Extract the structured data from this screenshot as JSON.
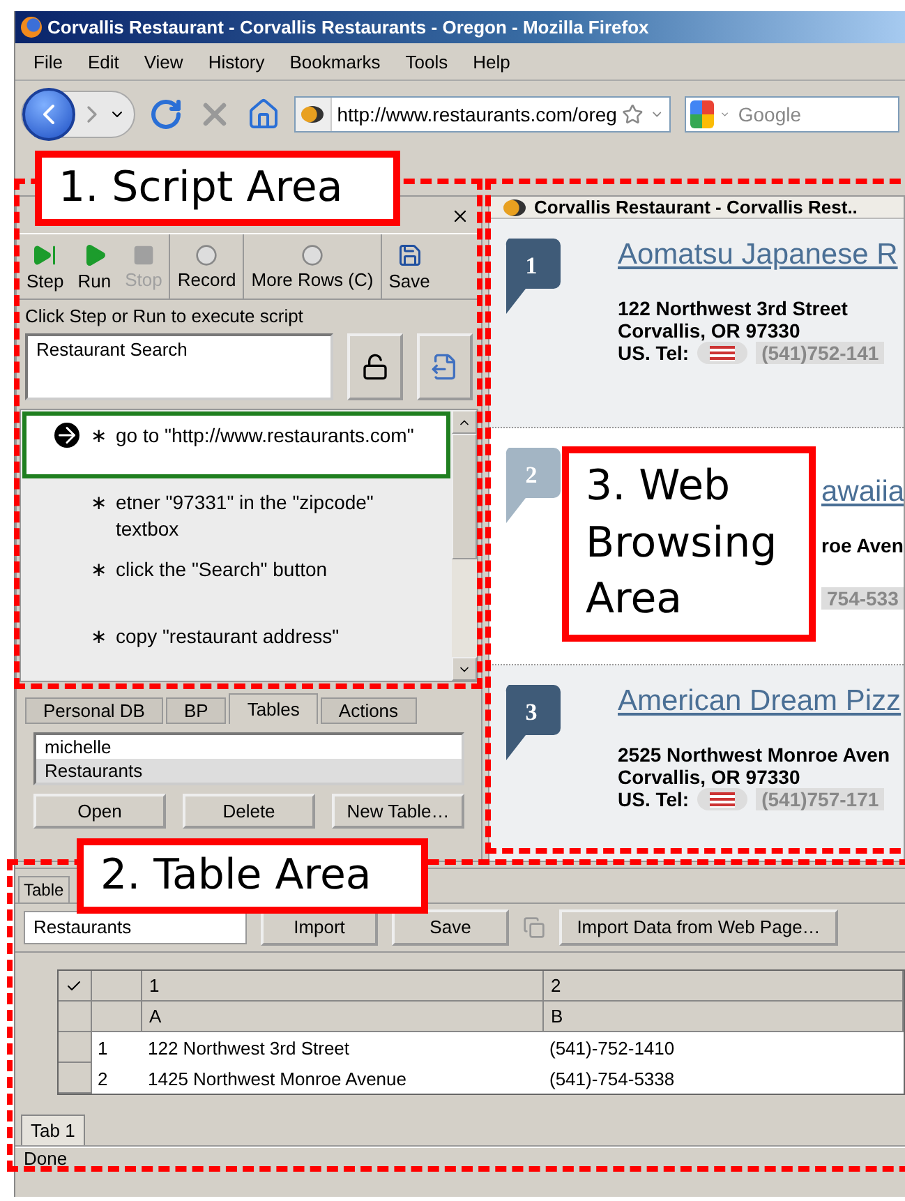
{
  "window": {
    "title": "Corvallis Restaurant - Corvallis Restaurants - Oregon - Mozilla Firefox"
  },
  "menu": [
    "File",
    "Edit",
    "View",
    "History",
    "Bookmarks",
    "Tools",
    "Help"
  ],
  "nav": {
    "url": "http://www.restaurants.com/oreg",
    "search_placeholder": "Google"
  },
  "sidebar": {
    "toolbar": [
      {
        "label": "Step",
        "kind": "step",
        "disabled": false
      },
      {
        "label": "Run",
        "kind": "run",
        "disabled": false
      },
      {
        "label": "Stop",
        "kind": "stop",
        "disabled": true
      },
      {
        "label": "Record",
        "kind": "record",
        "disabled": false
      },
      {
        "label": "More Rows (C)",
        "kind": "record",
        "disabled": false
      },
      {
        "label": "Save",
        "kind": "save",
        "disabled": false
      }
    ],
    "hint": "Click Step or Run to execute script",
    "script_name": "Restaurant Search",
    "steps": [
      {
        "bullet": "∗",
        "text": "go to \"http://www.restaurants.com\"",
        "selected": true
      },
      {
        "bullet": "∗",
        "text": "etner \"97331\" in the \"zipcode\" textbox",
        "selected": false
      },
      {
        "bullet": "∗",
        "text": "click the \"Search\" button",
        "selected": false
      },
      {
        "bullet": "∗",
        "text": "copy \"restaurant address\"",
        "selected": false
      }
    ],
    "tabs": [
      {
        "label": "Personal DB",
        "selected": false
      },
      {
        "label": "BP",
        "selected": false
      },
      {
        "label": "Tables",
        "selected": true
      },
      {
        "label": "Actions",
        "selected": false
      }
    ],
    "tables": [
      {
        "label": "michelle",
        "selected": true
      },
      {
        "label": "Restaurants",
        "selected": false
      }
    ],
    "buttons": [
      "Open",
      "Delete",
      "New Table…"
    ]
  },
  "web": {
    "tab_title": "Corvallis Restaurant - Corvallis Rest..",
    "results": [
      {
        "kind": "full",
        "marker": "1",
        "color": "#3f5b78",
        "name": "Aomatsu Japanese R",
        "address": "122 Northwest 3rd Street",
        "city": "Corvallis, OR 97330",
        "tel_label": "US. Tel:",
        "phone": "(541)752-141"
      },
      {
        "kind": "partial",
        "marker": "2",
        "color": "#a3b5c4",
        "name": "awaiia",
        "address": "roe Aven",
        "phone": "754-533"
      },
      {
        "kind": "full",
        "marker": "3",
        "color": "#3f5b78",
        "name": "American Dream Pizz",
        "address": "2525 Northwest Monroe Aven",
        "city": "Corvallis, OR 97330",
        "tel_label": "US. Tel:",
        "phone": "(541)757-171"
      }
    ]
  },
  "table_area": {
    "tab": "Table",
    "name": "Restaurants",
    "buttons": [
      "Import",
      "Save"
    ],
    "import_web": "Import Data from Web Page…",
    "column_numbers": [
      "1",
      "2"
    ],
    "column_letters": [
      "A",
      "B"
    ],
    "rows": [
      {
        "index": "1",
        "cells": [
          "122 Northwest 3rd Street",
          "(541)-752-1410"
        ]
      },
      {
        "index": "2",
        "cells": [
          "1425 Northwest Monroe Avenue",
          "(541)-754-5338"
        ]
      }
    ],
    "sheet_tabs": [
      {
        "label": "Tab 1",
        "selected": true
      }
    ]
  },
  "status_bar": "Done",
  "callouts": [
    "1. Script Area",
    "2. Table Area",
    "3. Web Browsing Area"
  ]
}
